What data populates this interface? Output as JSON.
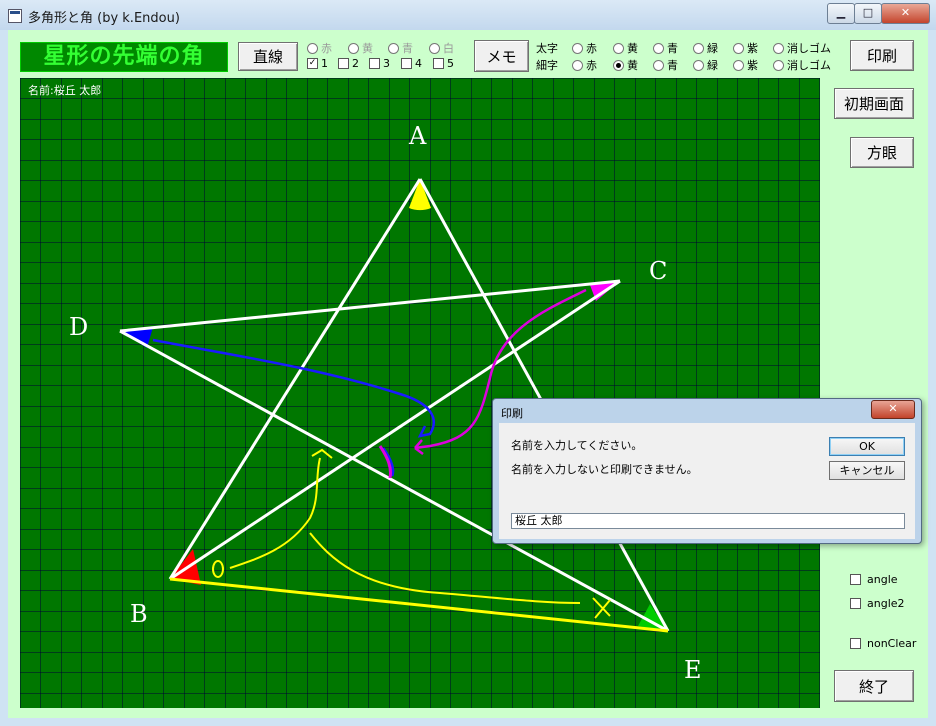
{
  "window": {
    "title": "多角形と角 (by k.Endou)",
    "controls": {
      "minimize": "▁",
      "maximize": "□",
      "close": "✕"
    }
  },
  "toolbar": {
    "banner": "星形の先端の角",
    "line_button": "直線",
    "memo_button": "メモ",
    "print_button": "印刷",
    "line_colors": [
      {
        "label": "赤",
        "selected": false
      },
      {
        "label": "黄",
        "selected": false
      },
      {
        "label": "青",
        "selected": false
      },
      {
        "label": "白",
        "selected": false
      }
    ],
    "line_checks": [
      {
        "label": "1",
        "checked": true
      },
      {
        "label": "2",
        "checked": false
      },
      {
        "label": "3",
        "checked": false
      },
      {
        "label": "4",
        "checked": false
      },
      {
        "label": "5",
        "checked": false
      }
    ],
    "thick_label": "太字",
    "thin_label": "細字",
    "thick_options": [
      {
        "label": "赤",
        "selected": false
      },
      {
        "label": "黄",
        "selected": false
      },
      {
        "label": "青",
        "selected": false
      },
      {
        "label": "緑",
        "selected": false
      },
      {
        "label": "紫",
        "selected": false
      },
      {
        "label": "消しゴム",
        "selected": false
      }
    ],
    "thin_options": [
      {
        "label": "赤",
        "selected": false
      },
      {
        "label": "黄",
        "selected": true
      },
      {
        "label": "青",
        "selected": false
      },
      {
        "label": "緑",
        "selected": false
      },
      {
        "label": "紫",
        "selected": false
      },
      {
        "label": "消しゴム",
        "selected": false
      }
    ]
  },
  "side": {
    "reset_button": "初期画面",
    "grid_button": "方眼",
    "exit_button": "終了",
    "checks": [
      {
        "label": "angle",
        "checked": false
      },
      {
        "label": "angle2",
        "checked": false
      },
      {
        "label": "nonClear",
        "checked": false
      }
    ]
  },
  "canvas": {
    "name_label": "名前:桜丘 太郎",
    "points": {
      "A": "A",
      "B": "B",
      "C": "C",
      "D": "D",
      "E": "E"
    },
    "colors": {
      "background": "#007700",
      "grid": "#000033",
      "lines": "#ffffff",
      "highlight_line": "#ffff00",
      "angle_A": "#ffff00",
      "angle_B": "#ff0000",
      "angle_C": "#ff00ff",
      "angle_D": "#0000ff",
      "angle_E": "#00cc00"
    }
  },
  "dialog": {
    "title": "印刷",
    "message1": "名前を入力してください。",
    "message2": "名前を入力しないと印刷できません。",
    "ok": "OK",
    "cancel": "キャンセル",
    "input_value": "桜丘 太郎",
    "close": "✕"
  }
}
